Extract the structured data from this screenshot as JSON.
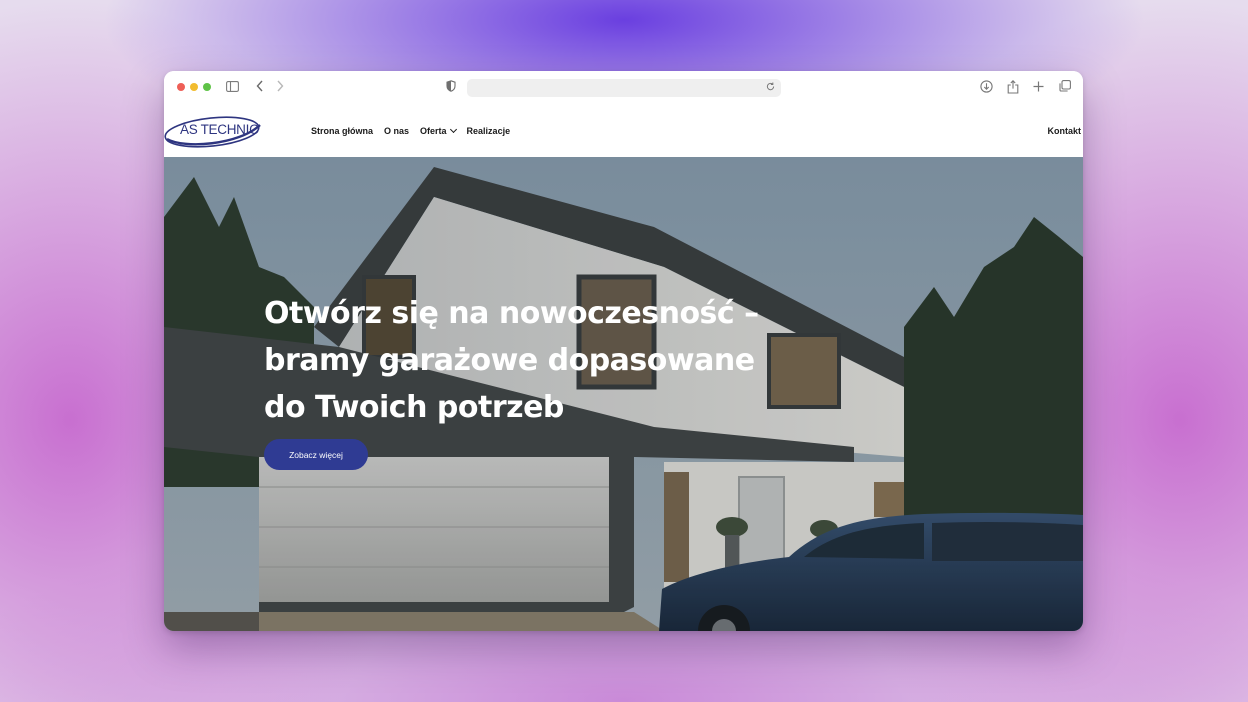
{
  "browser": {
    "url": ""
  },
  "site": {
    "logo_text": "AS TECHNIC",
    "nav": [
      {
        "label": "Strona główna"
      },
      {
        "label": "O nas"
      },
      {
        "label": "Oferta",
        "has_dropdown": true
      },
      {
        "label": "Realizacje"
      }
    ],
    "contact_label": "Kontakt"
  },
  "hero": {
    "title_lines": [
      "Otwórz się na nowoczesność –",
      "bramy garażowe dopasowane",
      "do Twoich potrzeb"
    ],
    "button_label": "Zobacz więcej"
  },
  "colors": {
    "brand_blue": "#2f3b93",
    "logo_blue": "#2e3580"
  },
  "icons": [
    "sidebar-icon",
    "back-icon",
    "forward-icon",
    "shield-icon",
    "reload-icon",
    "download-icon",
    "share-icon",
    "new-tab-icon",
    "tabs-overview-icon",
    "chevron-down-icon"
  ]
}
